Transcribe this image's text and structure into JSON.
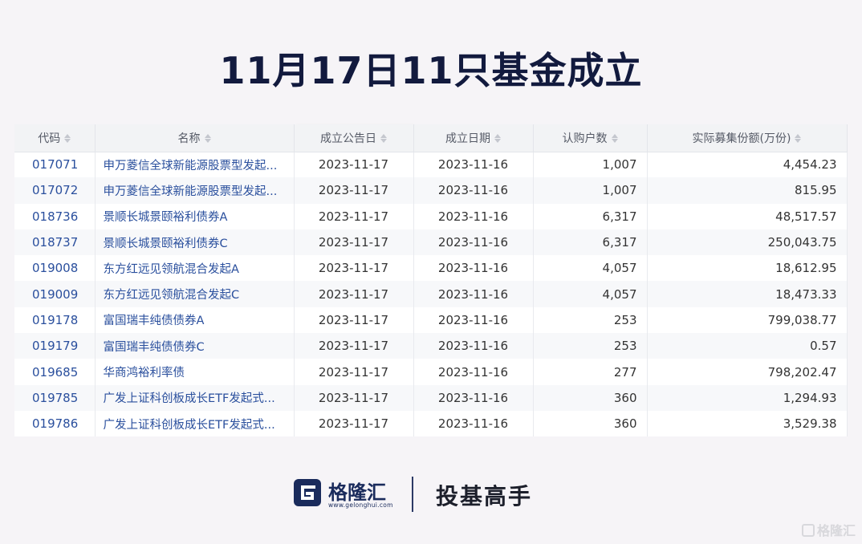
{
  "title": "11月17日11只基金成立",
  "table": {
    "headers": [
      "代码",
      "名称",
      "成立公告日",
      "成立日期",
      "认购户数",
      "实际募集份额(万份)"
    ],
    "rows": [
      [
        "017071",
        "申万菱信全球新能源股票型发起...",
        "2023-11-17",
        "2023-11-16",
        "1,007",
        "4,454.23"
      ],
      [
        "017072",
        "申万菱信全球新能源股票型发起...",
        "2023-11-17",
        "2023-11-16",
        "1,007",
        "815.95"
      ],
      [
        "018736",
        "景顺长城景颐裕利债券A",
        "2023-11-17",
        "2023-11-16",
        "6,317",
        "48,517.57"
      ],
      [
        "018737",
        "景顺长城景颐裕利债券C",
        "2023-11-17",
        "2023-11-16",
        "6,317",
        "250,043.75"
      ],
      [
        "019008",
        "东方红远见领航混合发起A",
        "2023-11-17",
        "2023-11-16",
        "4,057",
        "18,612.95"
      ],
      [
        "019009",
        "东方红远见领航混合发起C",
        "2023-11-17",
        "2023-11-16",
        "4,057",
        "18,473.33"
      ],
      [
        "019178",
        "富国瑞丰纯债债券A",
        "2023-11-17",
        "2023-11-16",
        "253",
        "799,038.77"
      ],
      [
        "019179",
        "富国瑞丰纯债债券C",
        "2023-11-17",
        "2023-11-16",
        "253",
        "0.57"
      ],
      [
        "019685",
        "华商鸿裕利率债",
        "2023-11-17",
        "2023-11-16",
        "277",
        "798,202.47"
      ],
      [
        "019785",
        "广发上证科创板成长ETF发起式...",
        "2023-11-17",
        "2023-11-16",
        "360",
        "1,294.93"
      ],
      [
        "019786",
        "广发上证科创板成长ETF发起式...",
        "2023-11-17",
        "2023-11-16",
        "360",
        "3,529.38"
      ]
    ]
  },
  "footer": {
    "brand": "格隆汇",
    "brand_url": "www.gelonghui.com",
    "slogan": "投基高手",
    "logo_icon": "gelonghui-g-logo-icon"
  },
  "watermark": {
    "text": "格隆汇",
    "icon": "gelonghui-g-logo-icon"
  },
  "colors": {
    "title": "#121a3e",
    "link": "#2a4f9d",
    "background": "#f6f4f7",
    "header_bg": "#f2f3f5"
  }
}
